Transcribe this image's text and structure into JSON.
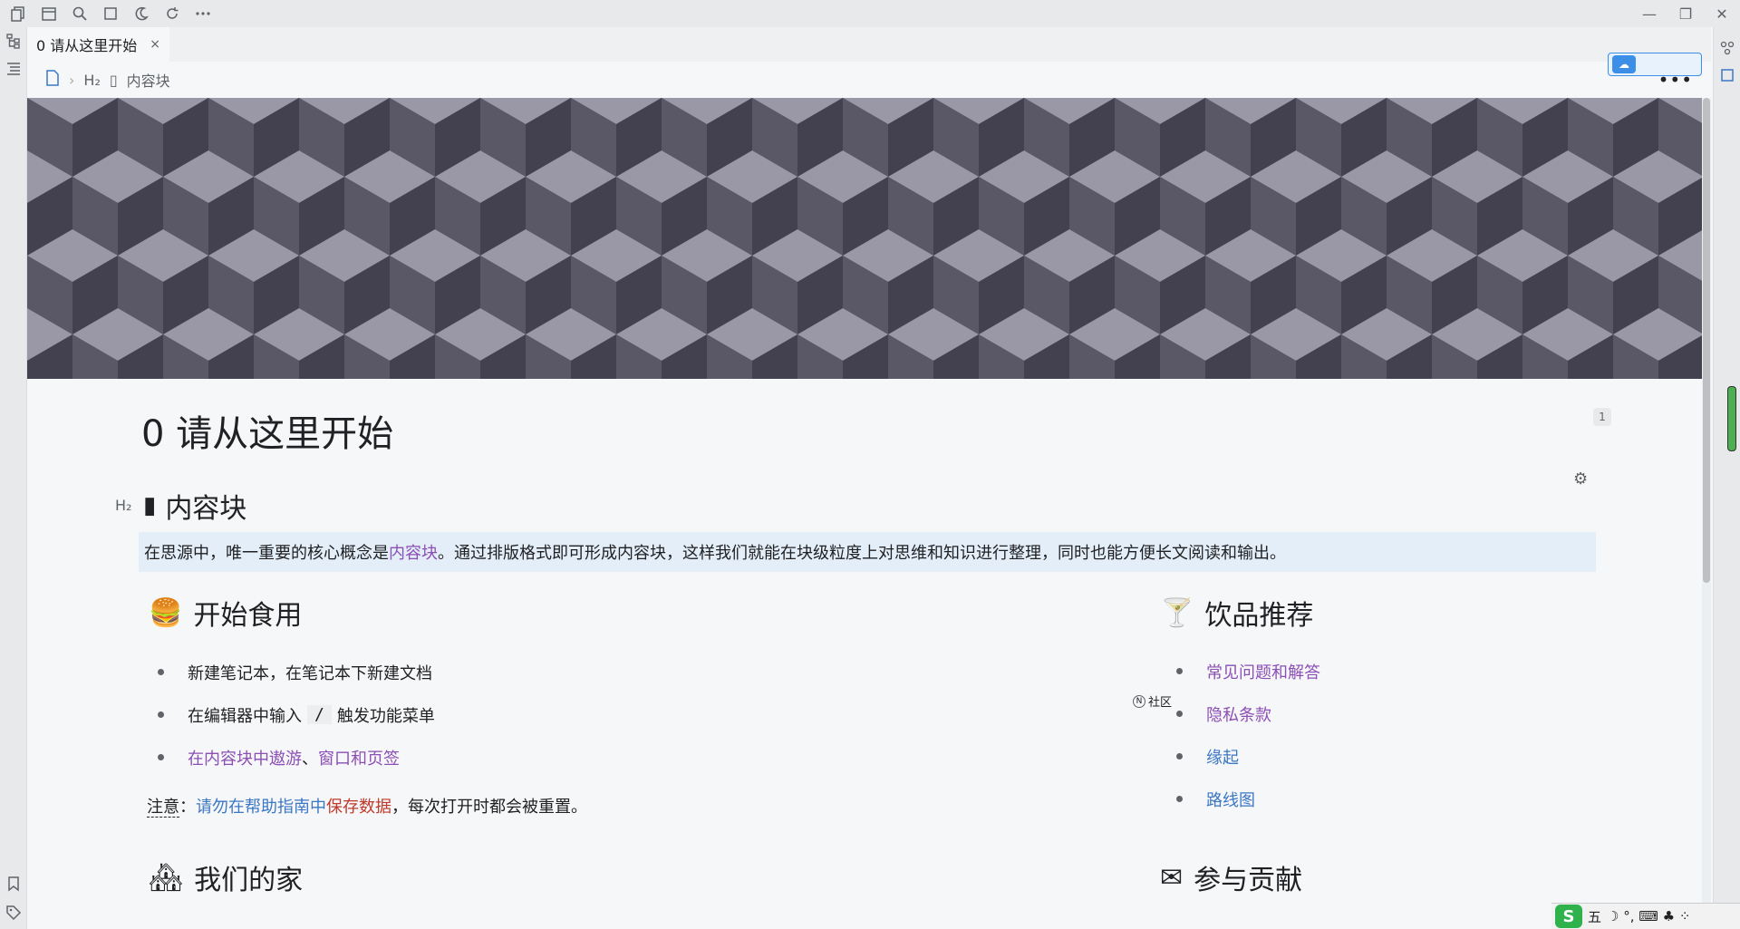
{
  "tab": {
    "title": "0 请从这里开始",
    "close": "×"
  },
  "sync": {
    "icon": "cloud-sync-icon",
    "label": ""
  },
  "breadcrumb": {
    "doc_icon": "file-icon",
    "heading_tag": "H₂",
    "item": "内容块",
    "more": "•••"
  },
  "page": {
    "title": "0 请从这里开始",
    "block_count": "1",
    "heading_gutter": "H₂",
    "section_heading": "内容块",
    "intro_before": "在思源中，唯一重要的核心概念是",
    "intro_link": "内容块",
    "intro_after": "。通过排版格式即可形成内容块，这样我们就能在块级粒度上对思维和知识进行整理，同时也能方便长文阅读和输出。"
  },
  "start": {
    "heading": "开始食用",
    "item1": "新建笔记本，在笔记本下新建文档",
    "item2_before": "在编辑器中输入",
    "item2_key": "/",
    "item2_after": "触发功能菜单",
    "item3_link1": "在内容块中遨游",
    "item3_sep": "、",
    "item3_link2": "窗口和页签"
  },
  "note": {
    "label": "注意",
    "colon": "：",
    "blue": "请勿在帮助指南中",
    "red": "保存数据",
    "rest": "，每次打开时都会被重置。"
  },
  "drinks": {
    "heading": "饮品推荐",
    "items": [
      "常见问题和解答",
      "隐私条款",
      "缘起",
      "路线图"
    ]
  },
  "home": {
    "heading": "我们的家"
  },
  "community_tag": {
    "mark": "N",
    "label": "社区"
  },
  "contribute": {
    "heading": "参与贡献"
  },
  "ime": {
    "logo": "S",
    "mode": "五",
    "items": "☽ °, ⌨ ♣ ⁘"
  }
}
